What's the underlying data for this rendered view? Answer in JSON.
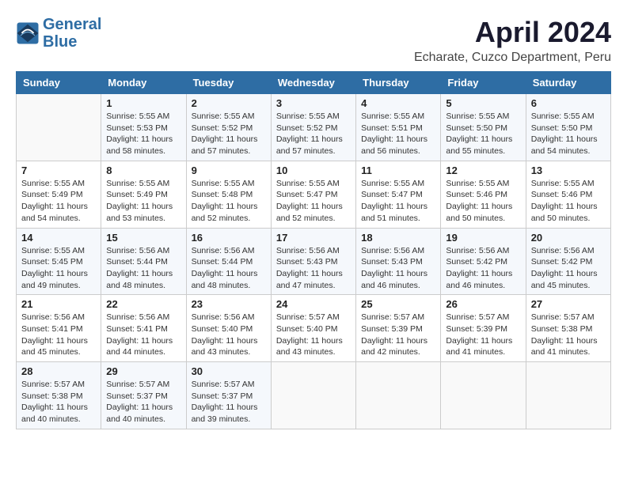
{
  "header": {
    "logo_line1": "General",
    "logo_line2": "Blue",
    "month_title": "April 2024",
    "location": "Echarate, Cuzco Department, Peru"
  },
  "weekdays": [
    "Sunday",
    "Monday",
    "Tuesday",
    "Wednesday",
    "Thursday",
    "Friday",
    "Saturday"
  ],
  "weeks": [
    [
      {
        "day": "",
        "info": ""
      },
      {
        "day": "1",
        "info": "Sunrise: 5:55 AM\nSunset: 5:53 PM\nDaylight: 11 hours\nand 58 minutes."
      },
      {
        "day": "2",
        "info": "Sunrise: 5:55 AM\nSunset: 5:52 PM\nDaylight: 11 hours\nand 57 minutes."
      },
      {
        "day": "3",
        "info": "Sunrise: 5:55 AM\nSunset: 5:52 PM\nDaylight: 11 hours\nand 57 minutes."
      },
      {
        "day": "4",
        "info": "Sunrise: 5:55 AM\nSunset: 5:51 PM\nDaylight: 11 hours\nand 56 minutes."
      },
      {
        "day": "5",
        "info": "Sunrise: 5:55 AM\nSunset: 5:50 PM\nDaylight: 11 hours\nand 55 minutes."
      },
      {
        "day": "6",
        "info": "Sunrise: 5:55 AM\nSunset: 5:50 PM\nDaylight: 11 hours\nand 54 minutes."
      }
    ],
    [
      {
        "day": "7",
        "info": "Sunrise: 5:55 AM\nSunset: 5:49 PM\nDaylight: 11 hours\nand 54 minutes."
      },
      {
        "day": "8",
        "info": "Sunrise: 5:55 AM\nSunset: 5:49 PM\nDaylight: 11 hours\nand 53 minutes."
      },
      {
        "day": "9",
        "info": "Sunrise: 5:55 AM\nSunset: 5:48 PM\nDaylight: 11 hours\nand 52 minutes."
      },
      {
        "day": "10",
        "info": "Sunrise: 5:55 AM\nSunset: 5:47 PM\nDaylight: 11 hours\nand 52 minutes."
      },
      {
        "day": "11",
        "info": "Sunrise: 5:55 AM\nSunset: 5:47 PM\nDaylight: 11 hours\nand 51 minutes."
      },
      {
        "day": "12",
        "info": "Sunrise: 5:55 AM\nSunset: 5:46 PM\nDaylight: 11 hours\nand 50 minutes."
      },
      {
        "day": "13",
        "info": "Sunrise: 5:55 AM\nSunset: 5:46 PM\nDaylight: 11 hours\nand 50 minutes."
      }
    ],
    [
      {
        "day": "14",
        "info": "Sunrise: 5:55 AM\nSunset: 5:45 PM\nDaylight: 11 hours\nand 49 minutes."
      },
      {
        "day": "15",
        "info": "Sunrise: 5:56 AM\nSunset: 5:44 PM\nDaylight: 11 hours\nand 48 minutes."
      },
      {
        "day": "16",
        "info": "Sunrise: 5:56 AM\nSunset: 5:44 PM\nDaylight: 11 hours\nand 48 minutes."
      },
      {
        "day": "17",
        "info": "Sunrise: 5:56 AM\nSunset: 5:43 PM\nDaylight: 11 hours\nand 47 minutes."
      },
      {
        "day": "18",
        "info": "Sunrise: 5:56 AM\nSunset: 5:43 PM\nDaylight: 11 hours\nand 46 minutes."
      },
      {
        "day": "19",
        "info": "Sunrise: 5:56 AM\nSunset: 5:42 PM\nDaylight: 11 hours\nand 46 minutes."
      },
      {
        "day": "20",
        "info": "Sunrise: 5:56 AM\nSunset: 5:42 PM\nDaylight: 11 hours\nand 45 minutes."
      }
    ],
    [
      {
        "day": "21",
        "info": "Sunrise: 5:56 AM\nSunset: 5:41 PM\nDaylight: 11 hours\nand 45 minutes."
      },
      {
        "day": "22",
        "info": "Sunrise: 5:56 AM\nSunset: 5:41 PM\nDaylight: 11 hours\nand 44 minutes."
      },
      {
        "day": "23",
        "info": "Sunrise: 5:56 AM\nSunset: 5:40 PM\nDaylight: 11 hours\nand 43 minutes."
      },
      {
        "day": "24",
        "info": "Sunrise: 5:57 AM\nSunset: 5:40 PM\nDaylight: 11 hours\nand 43 minutes."
      },
      {
        "day": "25",
        "info": "Sunrise: 5:57 AM\nSunset: 5:39 PM\nDaylight: 11 hours\nand 42 minutes."
      },
      {
        "day": "26",
        "info": "Sunrise: 5:57 AM\nSunset: 5:39 PM\nDaylight: 11 hours\nand 41 minutes."
      },
      {
        "day": "27",
        "info": "Sunrise: 5:57 AM\nSunset: 5:38 PM\nDaylight: 11 hours\nand 41 minutes."
      }
    ],
    [
      {
        "day": "28",
        "info": "Sunrise: 5:57 AM\nSunset: 5:38 PM\nDaylight: 11 hours\nand 40 minutes."
      },
      {
        "day": "29",
        "info": "Sunrise: 5:57 AM\nSunset: 5:37 PM\nDaylight: 11 hours\nand 40 minutes."
      },
      {
        "day": "30",
        "info": "Sunrise: 5:57 AM\nSunset: 5:37 PM\nDaylight: 11 hours\nand 39 minutes."
      },
      {
        "day": "",
        "info": ""
      },
      {
        "day": "",
        "info": ""
      },
      {
        "day": "",
        "info": ""
      },
      {
        "day": "",
        "info": ""
      }
    ]
  ]
}
